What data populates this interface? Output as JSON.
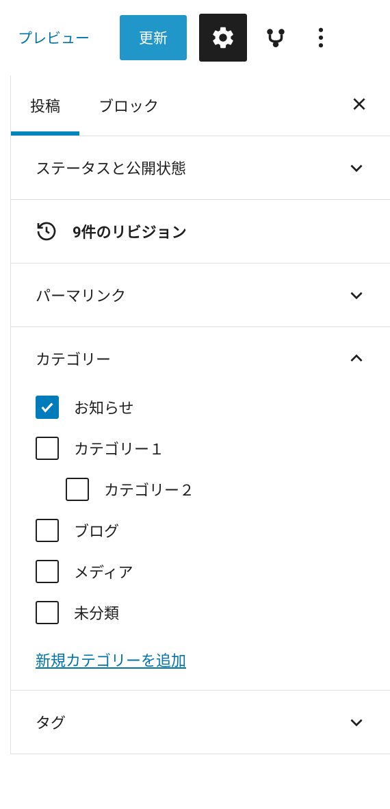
{
  "toolbar": {
    "preview_label": "プレビュー",
    "update_label": "更新"
  },
  "tabs": {
    "post": "投稿",
    "block": "ブロック"
  },
  "panels": {
    "status": "ステータスと公開状態",
    "revisions": "9件のリビジョン",
    "permalink": "パーマリンク",
    "categories": "カテゴリー",
    "tags": "タグ"
  },
  "categories": {
    "items": [
      {
        "label": "お知らせ",
        "checked": true,
        "nested": false
      },
      {
        "label": "カテゴリー１",
        "checked": false,
        "nested": false
      },
      {
        "label": "カテゴリー２",
        "checked": false,
        "nested": true
      },
      {
        "label": "ブログ",
        "checked": false,
        "nested": false
      },
      {
        "label": "メディア",
        "checked": false,
        "nested": false
      },
      {
        "label": "未分類",
        "checked": false,
        "nested": false
      }
    ],
    "add_new": "新規カテゴリーを追加"
  }
}
